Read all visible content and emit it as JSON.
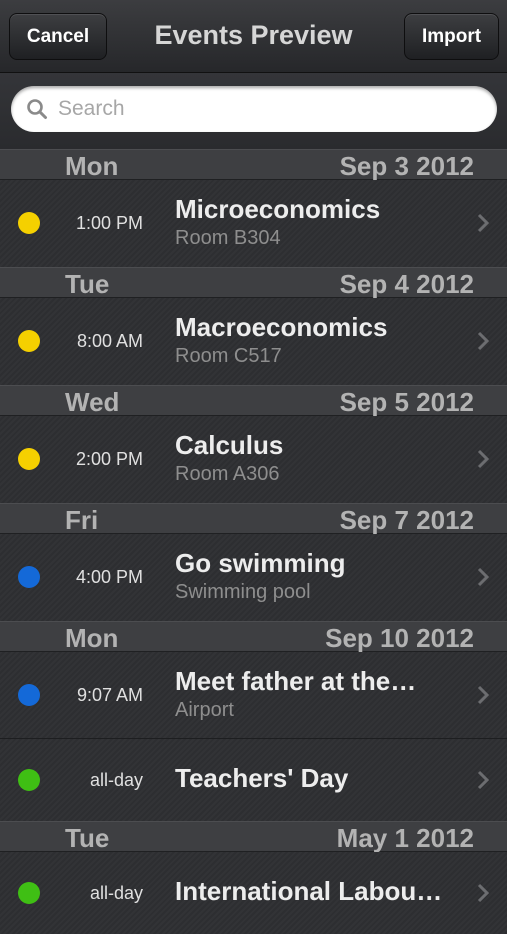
{
  "nav": {
    "cancel_label": "Cancel",
    "title": "Events Preview",
    "import_label": "Import"
  },
  "search": {
    "placeholder": "Search"
  },
  "colors": {
    "yellow": "#f5d000",
    "blue": "#1469d8",
    "green": "#3fbf14"
  },
  "sections": [
    {
      "day": "Mon",
      "date": "Sep 3 2012"
    },
    {
      "day": "Tue",
      "date": "Sep 4 2012"
    },
    {
      "day": "Wed",
      "date": "Sep 5 2012"
    },
    {
      "day": "Fri",
      "date": "Sep 7 2012"
    },
    {
      "day": "Mon",
      "date": "Sep 10 2012"
    },
    {
      "day": "Tue",
      "date": "May 1 2012"
    }
  ],
  "events": [
    {
      "time": "1:00 PM",
      "title": "Microeconomics",
      "location": "Room B304",
      "color": "yellow"
    },
    {
      "time": "8:00 AM",
      "title": "Macroeconomics",
      "location": "Room C517",
      "color": "yellow"
    },
    {
      "time": "2:00 PM",
      "title": "Calculus",
      "location": "Room A306",
      "color": "yellow"
    },
    {
      "time": "4:00 PM",
      "title": "Go swimming",
      "location": "Swimming pool",
      "color": "blue"
    },
    {
      "time": "9:07 AM",
      "title": "Meet father at the…",
      "location": "Airport",
      "color": "blue"
    },
    {
      "time": "all-day",
      "title": "Teachers' Day",
      "location": "",
      "color": "green"
    },
    {
      "time": "all-day",
      "title": "International Labou…",
      "location": "",
      "color": "green"
    }
  ]
}
